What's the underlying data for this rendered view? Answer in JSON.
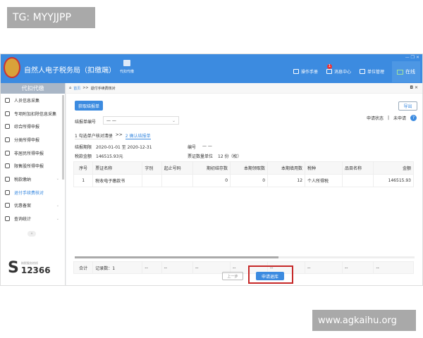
{
  "watermarks": [
    "TG: MYYJJPP",
    "www.agkaihu.org"
  ],
  "header": {
    "title": "自然人电子税务局（扣缴端）",
    "module": "代扣代缴",
    "nav": [
      "操作手册",
      "消息中心",
      "单位管理"
    ],
    "badge": "1",
    "online": "在线",
    "window_controls": "— ❐ ✕"
  },
  "sidebar": {
    "title": "代扣代缴",
    "items": [
      {
        "label": "人员信息采集",
        "icon": "person-icon"
      },
      {
        "label": "专项附加扣除信息采集",
        "icon": "list-icon"
      },
      {
        "label": "综合所得申报",
        "icon": "layers-icon"
      },
      {
        "label": "分类所得申报",
        "icon": "pie-icon"
      },
      {
        "label": "非居民所得申报",
        "icon": "person-icon"
      },
      {
        "label": "限售股所得申报",
        "icon": "bar-chart-icon"
      },
      {
        "label": "税款缴纳",
        "icon": "folder-icon",
        "chevron": "⌄"
      },
      {
        "label": "退付手续费核对",
        "icon": "document-icon",
        "active": true
      },
      {
        "label": "优惠备案",
        "icon": "file-icon",
        "chevron": "⌄"
      },
      {
        "label": "查询统计",
        "icon": "search-icon",
        "chevron": "⌄"
      }
    ],
    "collapse": "«",
    "hotline_label": "纳税服务热线",
    "hotline": "12366"
  },
  "breadcrumb": {
    "home": "首页",
    "sep": ">>",
    "current": "退付手续费核对",
    "controls": "◘ ✕"
  },
  "toolbar": {
    "get_button": "获取结报单",
    "export": "导出",
    "status_label": "申请状态",
    "status_sep": "|",
    "status_value": "未申请",
    "help": "?"
  },
  "form": {
    "bill_no_label": "结报单编号",
    "bill_no_value": "— —",
    "chevron": "⌄"
  },
  "steps": {
    "step1": "1 勾选单户核对清册",
    "sep": ">>",
    "step2": "2 确认结报单"
  },
  "info": {
    "period_label": "结报期限",
    "period": "2020-01-01  至  2020-12-31",
    "no_label": "编号",
    "no_value": "— —",
    "amount_label": "税款金额",
    "amount": "146515.93元",
    "count_label": "票证数量单位",
    "count": "12 份（枚）"
  },
  "table": {
    "headers": [
      "序号",
      "票证名称",
      "字别",
      "起止号码",
      "期初结存数",
      "本期领取数",
      "本期填用数",
      "税种",
      "品目名称",
      "金额"
    ],
    "rows": [
      [
        "1",
        "税收电子缴款书",
        "",
        "",
        "0",
        "0",
        "12",
        "个人所得税",
        "",
        "146515.93"
      ]
    ],
    "footer": [
      "合计",
      "记录数：1",
      "--",
      "--",
      "--",
      "--",
      "--",
      "--",
      "--",
      "--"
    ]
  },
  "actions": {
    "prev": "上一步",
    "apply": "申请退库"
  }
}
